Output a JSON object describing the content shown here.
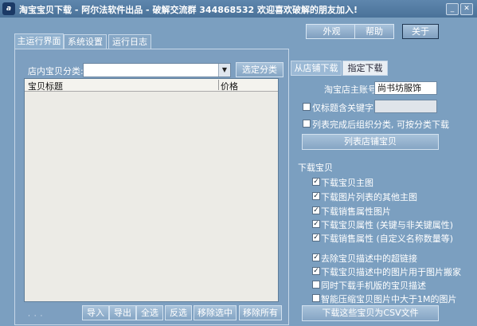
{
  "window": {
    "title": "淘宝宝贝下载 - 阿尔法软件出品 - 破解交流群 344868532  欢迎喜欢破解的朋友加入!",
    "app_icon_text": "a",
    "controls": [
      "minimize-icon",
      "close-icon"
    ]
  },
  "top_buttons": {
    "appearance": "外观",
    "help": "帮助",
    "about": "关于"
  },
  "tabs": [
    {
      "label": "主运行界面",
      "active": true
    },
    {
      "label": "系统设置",
      "active": false
    },
    {
      "label": "运行日志",
      "active": false
    }
  ],
  "left": {
    "category_label": "店内宝贝分类:",
    "category_value": "",
    "select_category_button": "选定分类",
    "table": {
      "columns": [
        "宝贝标题",
        "价格"
      ],
      "rows": []
    },
    "bottom_buttons": {
      "import": "导入",
      "export": "导出",
      "select_all": "全选",
      "invert": "反选",
      "remove_selected": "移除选中",
      "remove_all": "移除所有"
    }
  },
  "right": {
    "tabs": [
      {
        "label": "从店铺下载",
        "active": true
      },
      {
        "label": "指定下载",
        "active": false
      }
    ],
    "shop_owner_label": "淘宝店主账号",
    "shop_owner_value": "尚书坊服饰",
    "keyword_only_label": "仅标题含关键字",
    "keyword_value": "",
    "category_download_label": "列表完成后组织分类, 可按分类下载",
    "list_button": "列表店铺宝贝",
    "download_group_title": "下载宝贝",
    "options": [
      {
        "label": "下载宝贝主图",
        "checked": true
      },
      {
        "label": "下载图片列表的其他主图",
        "checked": true
      },
      {
        "label": "下载销售属性图片",
        "checked": true
      },
      {
        "label": "下载宝贝属性 (关键与非关键属性)",
        "checked": true
      },
      {
        "label": "下载销售属性 (自定义名称数量等)",
        "checked": true
      },
      {
        "label": "去除宝贝描述中的超链接",
        "checked": true
      },
      {
        "label": "下载宝贝描述中的图片用于图片搬家",
        "checked": true
      },
      {
        "label": "同时下载手机版的宝贝描述",
        "checked": false
      },
      {
        "label": "智能压缩宝贝图片中大于1M的图片",
        "checked": false
      }
    ],
    "download_csv_button": "下载这些宝贝为CSV文件"
  },
  "colors": {
    "window_bg": "#7b9fc0",
    "titlebar": "#4a7299",
    "list_bg": "#ecebe6"
  }
}
